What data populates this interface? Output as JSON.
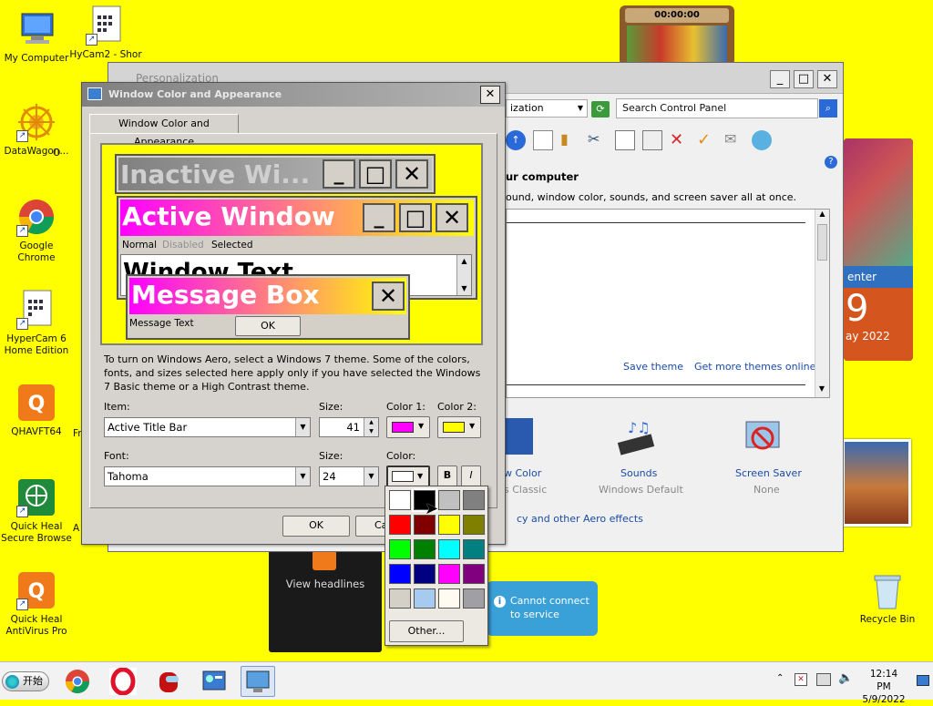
{
  "desktop": {
    "icons": [
      {
        "label": "My Computer"
      },
      {
        "label": "HyCam2 - Shor"
      },
      {
        "label": "DataWagon..."
      },
      {
        "label": "O"
      },
      {
        "label": "Google Chrome"
      },
      {
        "label": "HyperCam 6 Home Edition"
      },
      {
        "label": "QHAVFT64"
      },
      {
        "label": "Fr"
      },
      {
        "label": "Quick Heal Secure Browse"
      },
      {
        "label": "A"
      },
      {
        "label": "Quick Heal AntiVirus Pro"
      },
      {
        "label": "Recycle Bin"
      }
    ]
  },
  "gadgets": {
    "timer": "00:00:00",
    "calendar_center": "enter",
    "calendar_day": "9",
    "calendar_month": "ay 2022",
    "feed_label": "View headlines",
    "weather_text": "Cannot connect to service"
  },
  "personalization": {
    "title": "Personalization",
    "address_text": "ization",
    "search_placeholder": "Search Control Panel",
    "heading": "ur computer",
    "subheading": "ound, window color, sounds, and screen saver all at once.",
    "save_theme": "Save theme",
    "more_themes": "Get more themes online",
    "color_label": "w Color",
    "color_sub": "s Classic",
    "sounds_label": "Sounds",
    "sounds_sub": "Windows Default",
    "screensaver_label": "Screen Saver",
    "screensaver_sub": "None",
    "aero_link": "cy and other Aero effects"
  },
  "dialog": {
    "title": "Window Color and Appearance",
    "tab": "Window Color and Appearance",
    "preview": {
      "inactive": "Inactive Wi...",
      "active": "Active Window",
      "menu_normal": "Normal",
      "menu_disabled": "Disabled",
      "menu_selected": "Selected",
      "window_text": "Window Text",
      "message_box": "Message Box",
      "message_text": "Message Text",
      "ok": "OK"
    },
    "description": "To turn on Windows Aero, select a Windows 7 theme.  Some of the colors, fonts, and sizes selected here apply only if you have selected the Windows 7 Basic theme or a High Contrast theme.",
    "item_label": "Item:",
    "item_value": "Active Title Bar",
    "size_label": "Size:",
    "size_value": "41",
    "color1_label": "Color 1:",
    "color2_label": "Color 2:",
    "font_label": "Font:",
    "font_value": "Tahoma",
    "font_size_label": "Size:",
    "font_size_value": "24",
    "font_color_label": "Color:",
    "bold_label": "B",
    "italic_label": "I",
    "ok_button": "OK",
    "cancel_button": "Ca",
    "colors": {
      "color1": "#ff00ff",
      "color2": "#ffff00",
      "font_color": "#ffffff"
    }
  },
  "palette": {
    "colors": [
      "#ffffff",
      "#000000",
      "#c0c0c0",
      "#808080",
      "#ff0000",
      "#800000",
      "#ffff00",
      "#808000",
      "#00ff00",
      "#008000",
      "#00ffff",
      "#008080",
      "#0000ff",
      "#000080",
      "#ff00ff",
      "#800080",
      "#d4d0c8",
      "#a6caf0",
      "#fffbf0",
      "#a0a0a4"
    ],
    "other_button": "Other..."
  },
  "taskbar": {
    "start_label": "开始",
    "time": "12:14 PM",
    "date": "5/9/2022"
  }
}
